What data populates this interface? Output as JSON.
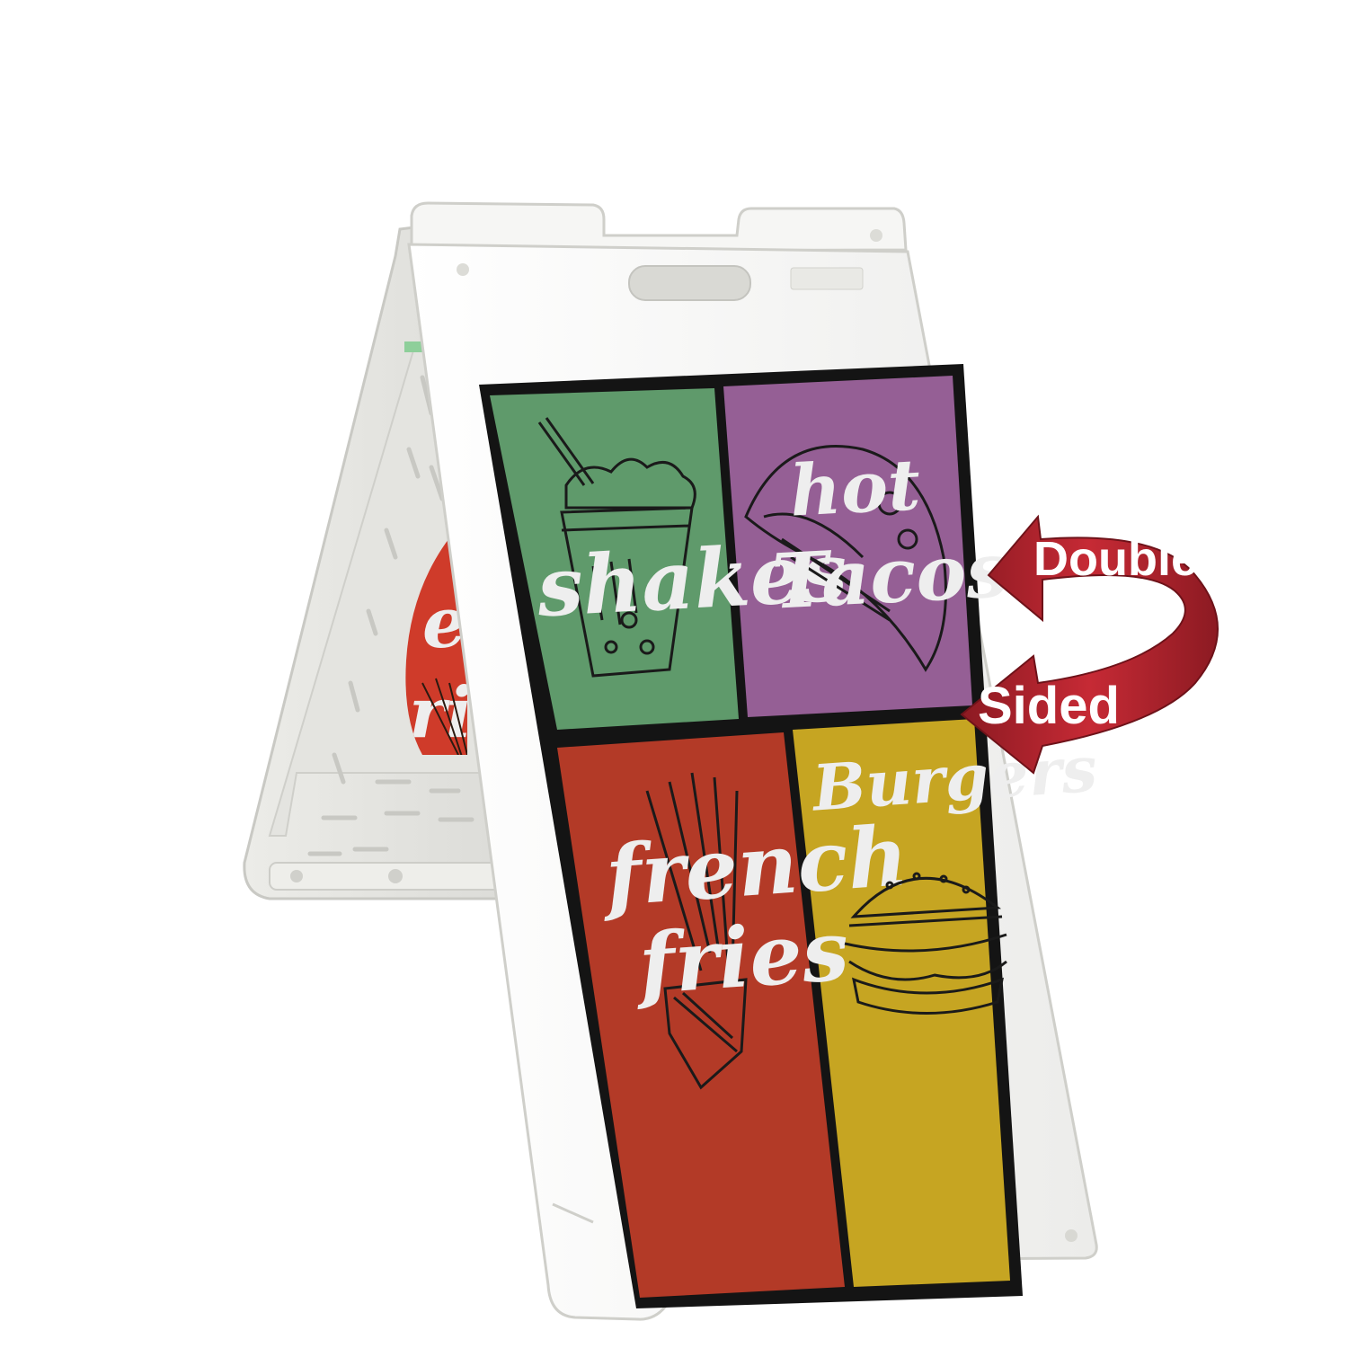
{
  "panels": [
    {
      "id": "shakes",
      "lines": [
        "shakes"
      ],
      "color": "#5f9a6b"
    },
    {
      "id": "tacos",
      "lines": [
        "hot",
        "Tacos"
      ],
      "color": "#955f95"
    },
    {
      "id": "fries",
      "lines": [
        "french",
        "fries"
      ],
      "color": "#b33a27"
    },
    {
      "id": "burgers",
      "lines": [
        "Burgers"
      ],
      "color": "#c6a522"
    }
  ],
  "back_panel": {
    "lines": [
      "en",
      "ries"
    ],
    "color": "#cf3b2a"
  },
  "callout": {
    "top": "Double",
    "bottom": "Sided",
    "color": "#b8242e"
  },
  "colors": {
    "frame": "#f4f4f2",
    "frame_shadow": "#d6d6d2",
    "sign_border": "#141414",
    "ink": "#1a1a1a"
  }
}
